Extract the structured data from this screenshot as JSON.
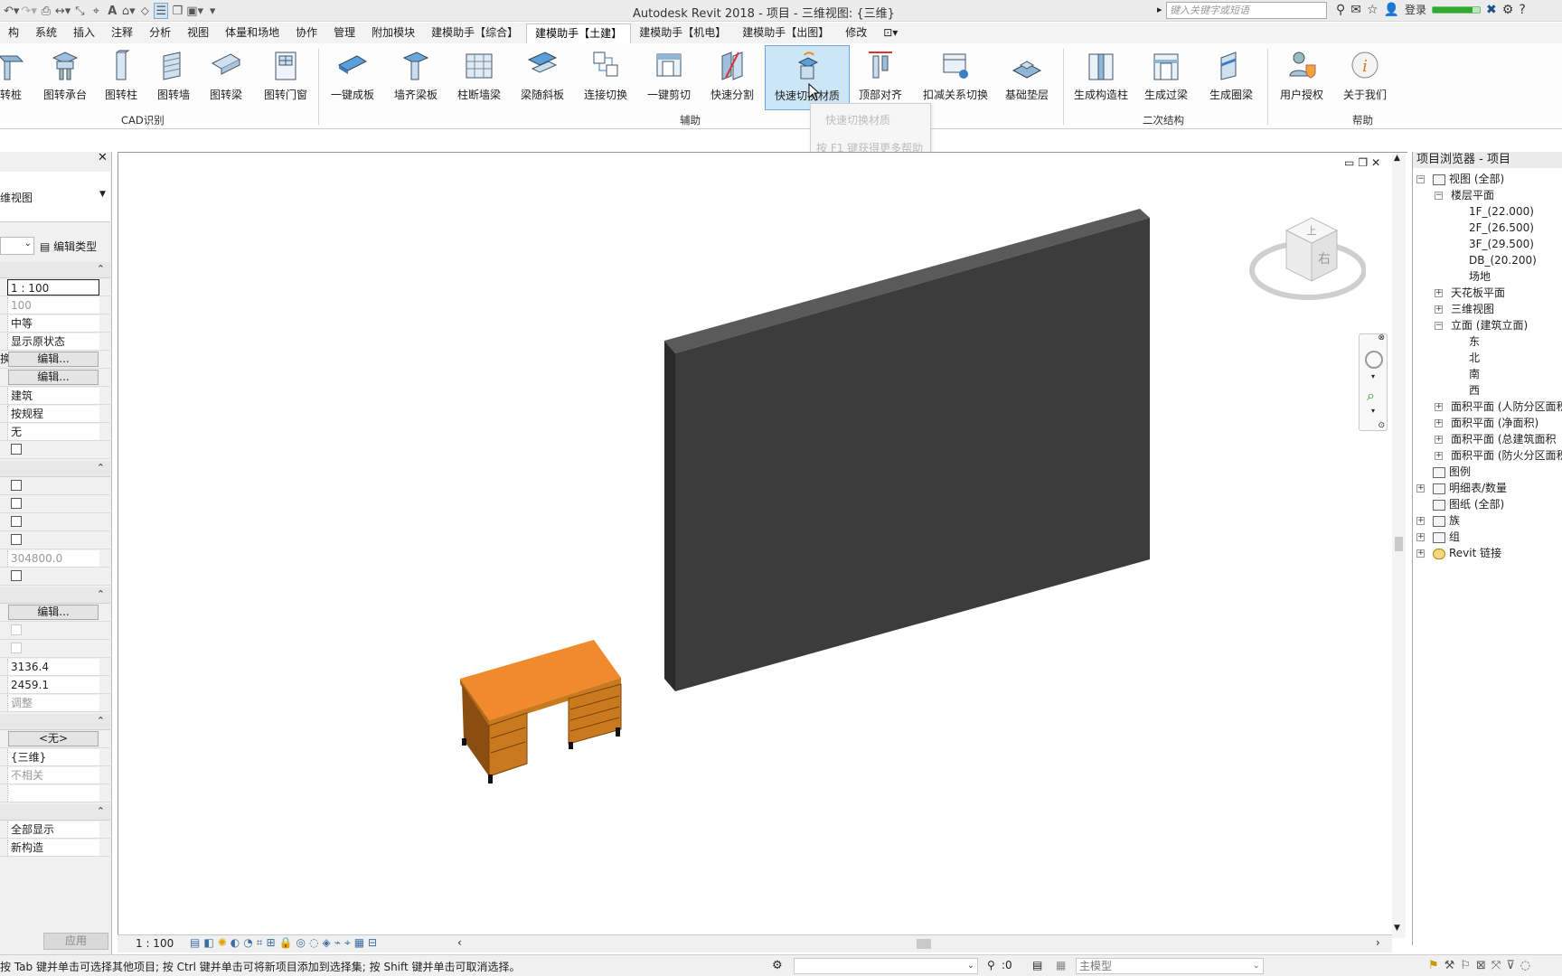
{
  "window": {
    "title": "Autodesk Revit 2018 -      项目 - 三维视图: {三维}"
  },
  "search": {
    "placeholder": "键入关键字或短语"
  },
  "account": {
    "login": "登录",
    "progress": 0.85
  },
  "tabs": [
    {
      "label": "构"
    },
    {
      "label": "系统"
    },
    {
      "label": "插入"
    },
    {
      "label": "注释"
    },
    {
      "label": "分析"
    },
    {
      "label": "视图"
    },
    {
      "label": "体量和场地"
    },
    {
      "label": "协作"
    },
    {
      "label": "管理"
    },
    {
      "label": "附加模块"
    },
    {
      "label": "建模助手【综合】"
    },
    {
      "label": "建模助手【土建】"
    },
    {
      "label": "建模助手【机电】"
    },
    {
      "label": "建模助手【出图】"
    },
    {
      "label": "修改"
    }
  ],
  "ribbon": {
    "cad": [
      "转桩",
      "图转承台",
      "图转柱",
      "图转墙",
      "图转梁",
      "图转门窗"
    ],
    "aux": [
      "一键成板",
      "墙齐梁板",
      "柱断墙梁",
      "梁随斜板",
      "连接切换",
      "一键剪切",
      "快速分割",
      "快速切换材质",
      "顶部对齐",
      "扣减关系切换",
      "基础垫层"
    ],
    "secondary": [
      "生成构造柱",
      "生成过梁",
      "生成圈梁"
    ],
    "help": [
      "用户授权",
      "关于我们"
    ],
    "panels": {
      "cad": "CAD识别",
      "aux": "辅助",
      "secondary": "二次结构",
      "help": "帮助"
    }
  },
  "tooltip": {
    "title": "快速切换材质",
    "hint": "按 F1 键获得更多帮助"
  },
  "properties": {
    "view_type": "维视图",
    "edit_type": "编辑类型",
    "scale": "1 : 100",
    "scale_value": "100",
    "detail": "中等",
    "display": "显示原状态",
    "edit": "编辑...",
    "discipline": "建筑",
    "by_discipline": "按规程",
    "none_text": "无",
    "rotation": "304800.0",
    "num1": "3136.4",
    "num2": "2459.1",
    "adjust": "调整",
    "none_btn": "<无>",
    "view3d": "{三维}",
    "unrelated": "不相关",
    "show_all": "全部显示",
    "new_const": "新构造",
    "apply": "应用",
    "side_label": "换"
  },
  "browser": {
    "title": "项目浏览器 - 项目",
    "views_all": "视图 (全部)",
    "floor_plans": "楼层平面",
    "levels": [
      "1F_(22.000)",
      "2F_(26.500)",
      "3F_(29.500)",
      "DB_(20.200)",
      "场地"
    ],
    "ceiling": "天花板平面",
    "views3d": "三维视图",
    "elevations": "立面 (建筑立面)",
    "dirs": [
      "东",
      "北",
      "南",
      "西"
    ],
    "areas": [
      "面积平面 (人防分区面积",
      "面积平面 (净面积)",
      "面积平面 (总建筑面积",
      "面积平面 (防火分区面积"
    ],
    "legend": "图例",
    "schedules": "明细表/数量",
    "sheets": "图纸 (全部)",
    "families": "族",
    "groups": "组",
    "links": "Revit 链接"
  },
  "viewcube": {
    "top": "上",
    "right": "右"
  },
  "vcbar": {
    "scale": "1 : 100"
  },
  "status": {
    "message": "按 Tab 键并单击可选择其他项目; 按 Ctrl 键并单击可将新项目添加到选择集; 按 Shift 键并单击可取消选择。",
    "count": ":0",
    "model": "主模型"
  },
  "colors": {
    "wall": "#3c3c3c",
    "desk_top": "#f08a2c",
    "desk_body": "#c97a1e",
    "accent": "#6fa8dc"
  }
}
